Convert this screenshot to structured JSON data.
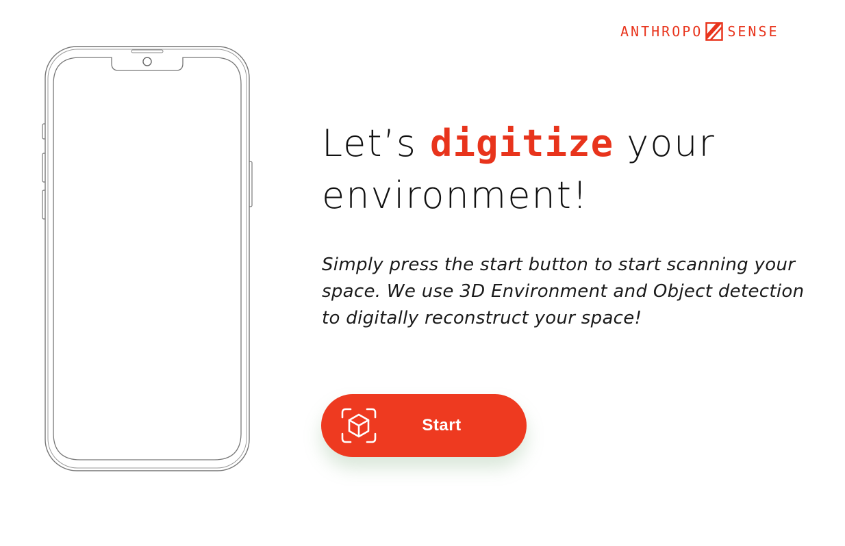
{
  "brand": {
    "name_left": "ANTHROPO",
    "name_right": "SENSE",
    "color": "#e8341c"
  },
  "hero": {
    "headline_before": "Let’s ",
    "headline_highlight": "digitize",
    "headline_after": " your environment!",
    "description": "Simply press the start button to start scanning your space. We use 3D Environment and Object detection to digitally reconstruct your space!"
  },
  "start_button": {
    "label": "Start",
    "icon": "scan-cube-icon",
    "color": "#ee3a20"
  },
  "phone": {
    "icon": "phone-outline-illustration"
  }
}
